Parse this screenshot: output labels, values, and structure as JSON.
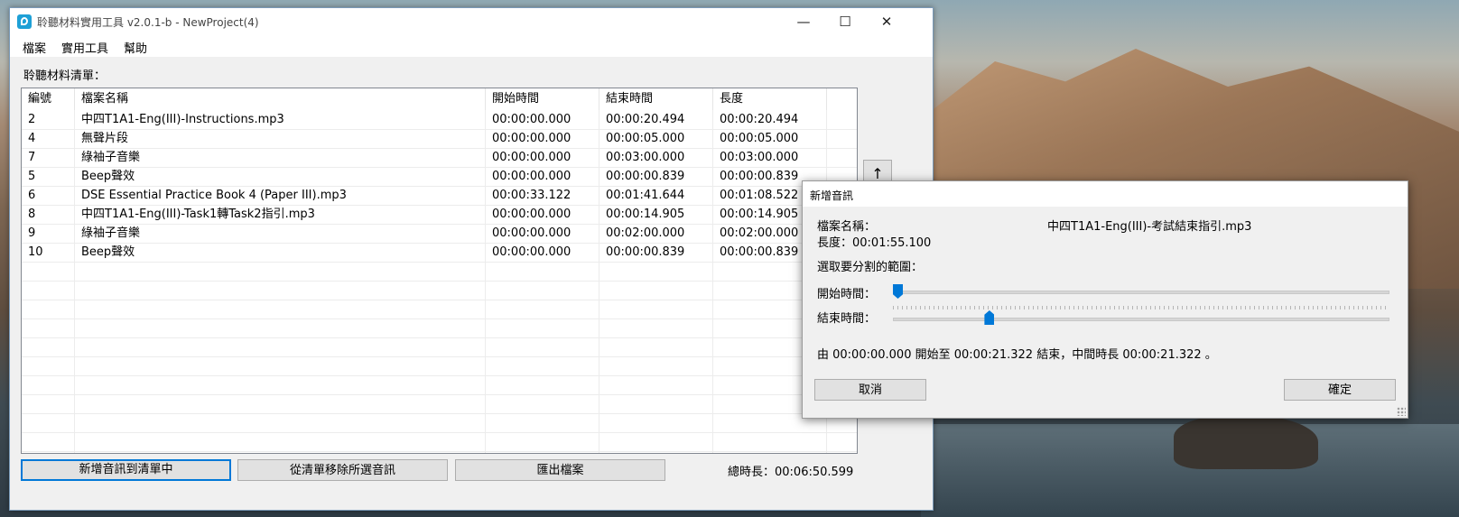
{
  "window": {
    "title": "聆聽材料實用工具 v2.0.1-b - NewProject(4)",
    "minimize": "—",
    "maximize": "☐",
    "close": "✕"
  },
  "menu": [
    "檔案",
    "實用工具",
    "幫助"
  ],
  "list_label": "聆聽材料清單：",
  "columns": [
    "編號",
    "檔案名稱",
    "開始時間",
    "結束時間",
    "長度"
  ],
  "rows": [
    [
      "2",
      "中四T1A1-Eng(III)-Instructions.mp3",
      "00:00:00.000",
      "00:00:20.494",
      "00:00:20.494"
    ],
    [
      "4",
      "無聲片段",
      "00:00:00.000",
      "00:00:05.000",
      "00:00:05.000"
    ],
    [
      "7",
      "綠袖子音樂",
      "00:00:00.000",
      "00:03:00.000",
      "00:03:00.000"
    ],
    [
      "5",
      "Beep聲效",
      "00:00:00.000",
      "00:00:00.839",
      "00:00:00.839"
    ],
    [
      "6",
      "DSE Essential Practice Book 4 (Paper III).mp3",
      "00:00:33.122",
      "00:01:41.644",
      "00:01:08.522"
    ],
    [
      "8",
      "中四T1A1-Eng(III)-Task1轉Task2指引.mp3",
      "00:00:00.000",
      "00:00:14.905",
      "00:00:14.905"
    ],
    [
      "9",
      "綠袖子音樂",
      "00:00:00.000",
      "00:02:00.000",
      "00:02:00.000"
    ],
    [
      "10",
      "Beep聲效",
      "00:00:00.000",
      "00:00:00.839",
      "00:00:00.839"
    ]
  ],
  "buttons": {
    "add": "新增音訊到清單中",
    "remove": "從清單移除所選音訊",
    "export": "匯出檔案",
    "move_up": "↑"
  },
  "total_length": "總時長：00:06:50.599",
  "dialog": {
    "title": "新增音訊",
    "file_label": "檔案名稱：",
    "file_name": "中四T1A1-Eng(III)-考試結束指引.mp3",
    "length": "長度：00:01:55.100",
    "range_label": "選取要分割的範圍：",
    "start_label": "開始時間：",
    "end_label": "結束時間：",
    "start_fraction": 0.0,
    "end_fraction": 0.185,
    "summary": "由 00:00:00.000 開始至 00:00:21.322 結束，中間時長 00:00:21.322 。",
    "cancel": "取消",
    "ok": "確定"
  }
}
